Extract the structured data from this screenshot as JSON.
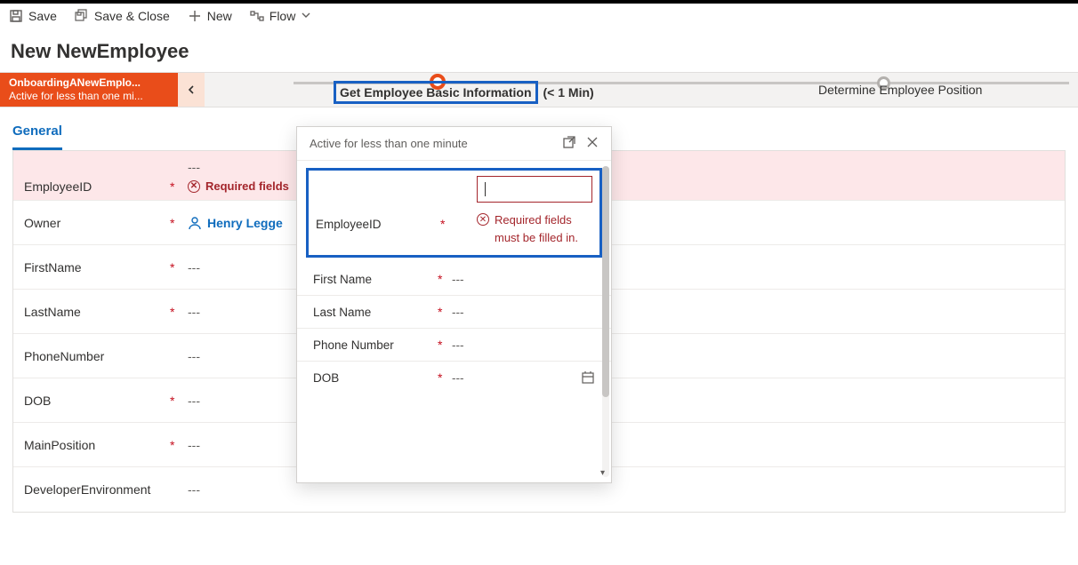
{
  "commands": {
    "save": "Save",
    "save_close": "Save & Close",
    "new": "New",
    "flow": "Flow"
  },
  "page_title": "New NewEmployee",
  "bpf": {
    "name": "OnboardingANewEmplo...",
    "status": "Active for less than one mi...",
    "stage1_label": "Get Employee Basic Information",
    "stage1_dur": "(< 1 Min)",
    "stage2_label": "Determine Employee Position"
  },
  "tabs": {
    "general": "General"
  },
  "form": {
    "employee_id_label": "EmployeeID",
    "employee_id_value": "---",
    "required_error": "Required fields",
    "owner_label": "Owner",
    "owner_value": "Henry Legge",
    "first_name_label": "FirstName",
    "first_name_value": "---",
    "last_name_label": "LastName",
    "last_name_value": "---",
    "phone_label": "PhoneNumber",
    "phone_value": "---",
    "dob_label": "DOB",
    "dob_value": "---",
    "main_position_label": "MainPosition",
    "main_position_value": "---",
    "dev_env_label": "DeveloperEnvironment",
    "dev_env_value": "---"
  },
  "flyout": {
    "title": "Active for less than one minute",
    "employee_id_label": "EmployeeID",
    "required_error": "Required fields must be filled in.",
    "first_name_label": "First Name",
    "first_name_value": "---",
    "last_name_label": "Last Name",
    "last_name_value": "---",
    "phone_label": "Phone Number",
    "phone_value": "---",
    "dob_label": "DOB",
    "dob_value": "---"
  }
}
